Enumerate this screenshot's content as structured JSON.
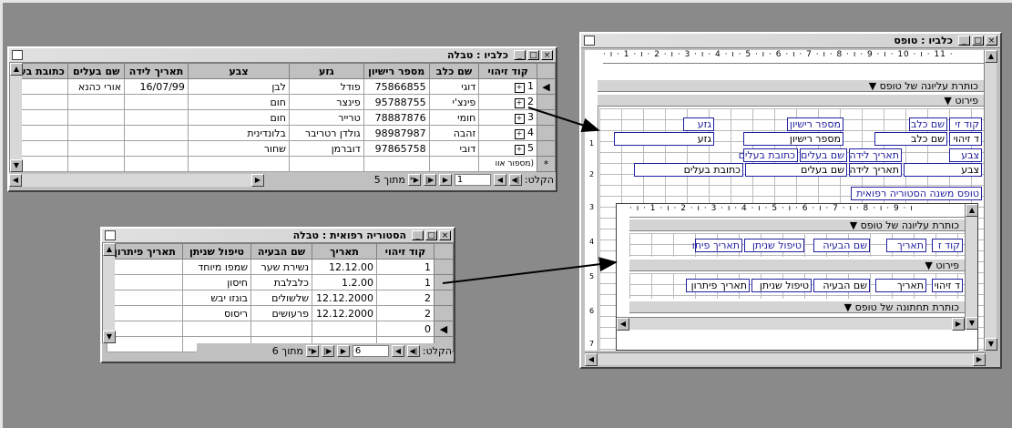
{
  "table_window": {
    "title": "כלביו : טבלה",
    "columns": [
      "קוד זיהוי",
      "שם כלב",
      "מספר רישיון",
      "גזע",
      "צבע",
      "תאריך לידה",
      "שם בעלים",
      "כתובת בעל"
    ],
    "rows": [
      {
        "id": "1",
        "name": "דוגי",
        "license": "75866855",
        "breed": "פודל",
        "color": "לבן",
        "birth": "16/07/99",
        "owner": "אורי כהנא"
      },
      {
        "id": "2",
        "name": "פינצ'י",
        "license": "95788755",
        "breed": "פינצר",
        "color": "חום",
        "birth": "",
        "owner": ""
      },
      {
        "id": "3",
        "name": "חומי",
        "license": "78887876",
        "breed": "טרייר",
        "color": "חום",
        "birth": "",
        "owner": ""
      },
      {
        "id": "4",
        "name": "זהבה",
        "license": "98987987",
        "breed": "גולדן רטריבר",
        "color": "בלונדינית",
        "birth": "",
        "owner": ""
      },
      {
        "id": "5",
        "name": "דובי",
        "license": "97865758",
        "breed": "דוברמן",
        "color": "שחור",
        "birth": "",
        "owner": ""
      }
    ],
    "new_row_label": "(מספור אוו",
    "nav": {
      "record_label": "הקלט:",
      "current": "1",
      "of_label": "מתוך 5"
    }
  },
  "history_window": {
    "title": "הסטוריה רפואית : טבלה",
    "columns": [
      "קוד זיהוי",
      "תאריך",
      "שם הבעיה",
      "טיפול שניתן",
      "תאריך פיתרון"
    ],
    "rows": [
      {
        "id": "1",
        "date": "12.12.00",
        "problem": "נשירת שער",
        "treatment": "שמפו מיוחד"
      },
      {
        "id": "1",
        "date": "1.2.00",
        "problem": "כלבלבת",
        "treatment": "חיסון"
      },
      {
        "id": "2",
        "date": "12.12.2000",
        "problem": "שלשולים",
        "treatment": "בונזו יבש"
      },
      {
        "id": "2",
        "date": "12.12.2000",
        "problem": "פרעושים",
        "treatment": "ריסוס"
      }
    ],
    "new_row_id": "0",
    "nav": {
      "record_label": "הקלט:",
      "current": "6",
      "of_label": "מתוך 6"
    }
  },
  "form_window": {
    "title": "כלביו : טופס",
    "ruler": "· ı · 1 · ı · 2 · ı · 3 · ı · 4 · ı · 5 · ı · 6 · ı · 7 · ı · 8 · ı · 9 · ı · 10 · ı · 11 ·",
    "vruler": [
      "1",
      "2",
      "3",
      "4",
      "5",
      "6",
      "7"
    ],
    "sections": {
      "header": "כותרת עליונה של טופס",
      "detail": "פירוט",
      "footer": "כותרת תחתונה של טופס"
    },
    "labels": {
      "id": "קוד זי",
      "dogname": "שם כלב",
      "license": "מספר רישיון",
      "breed": "גזע",
      "color": "צבע",
      "birth": "תאריך לידה",
      "owner": "שם בעלים",
      "address": "כתובת בעלים"
    },
    "fields": {
      "id": "ד זיהוי",
      "dogname": "שם כלב",
      "license": "מספר רישיון",
      "breed": "גזע",
      "color": "צבע",
      "birth": "תאריך לידה",
      "owner": "שם בעלים",
      "address": "כתובת בעלים"
    },
    "subform_label": "טופס משנה הסטוריה רפואית",
    "subform": {
      "ruler": "· ı · 1 · ı · 2 · ı · 3 · ı · 4 · ı · 5 · ı · 6 · ı · 7 · ı · 8 · ı · 9 · ı",
      "sections": {
        "header": "כותרת עליונה של טופס",
        "detail": "פירוט",
        "footer": "כותרת תחתונה של טופס"
      },
      "labels": {
        "id": "קוד ז",
        "date": "תאריך",
        "problem": "שם הבעיה",
        "treatment": "טיפול שניתן",
        "resolved": "תאריך פיתו"
      },
      "fields": {
        "id": "ד זיהוי",
        "date": "תאריך",
        "problem": "שם הבעיה",
        "treatment": "טיפול שניתן",
        "resolved": "תאריך פיתרון"
      }
    }
  }
}
